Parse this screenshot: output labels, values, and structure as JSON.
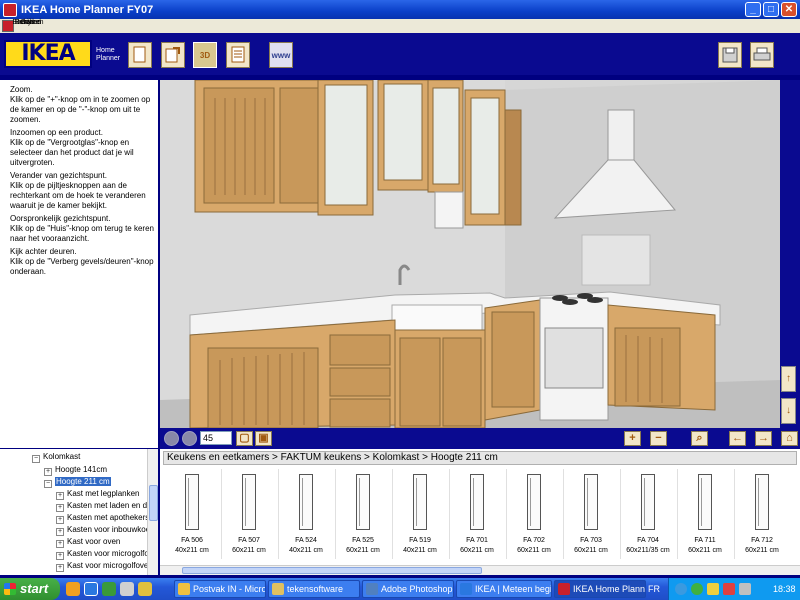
{
  "window": {
    "title": "IKEA Home Planner FY07"
  },
  "menu": [
    "Bestand",
    "Bewerken",
    "Bekijken",
    "Over"
  ],
  "brand": {
    "logo": "IKEA",
    "logo_sub1": "Home",
    "logo_sub2": "Planner"
  },
  "header_buttons": [
    "new-icon",
    "open-icon",
    "3d-view-icon",
    "list-icon",
    "www-icon",
    "save-icon",
    "print-icon"
  ],
  "header_button_labels": {
    "3d": "3D",
    "www": "www"
  },
  "help": [
    "Zoom.",
    "Klik op de \"+\"-knop om in te zoomen op de kamer en op de \"-\"-knop om uit te zoomen.",
    "Inzoomen op een product.",
    "Klik op de \"Vergrootglas\"-knop en selecteer dan het product dat je wil uitvergroten.",
    "Verander van gezichtspunt.",
    "Klik op de pijltjesknoppen aan de rechterkant om de hoek te veranderen waaruit je de kamer bekijkt.",
    "Oorspronkelijk gezichtspunt.",
    "Klik op de \"Huis\"-knop om terug te keren naar het vooraanzicht.",
    "Kijk achter deuren.",
    "Klik op de \"Verberg gevels/deuren\"-knop onderaan."
  ],
  "view_toolbar": {
    "zoom_value": "45"
  },
  "tree": [
    {
      "label": "Kolomkast",
      "toggle": "−",
      "level": 0
    },
    {
      "label": "Hoogte 141cm",
      "toggle": "+",
      "level": 1
    },
    {
      "label": "Hoogte 211 cm",
      "toggle": "−",
      "level": 1,
      "selected": true
    },
    {
      "label": "Kast met legplanken",
      "toggle": "+",
      "level": 2
    },
    {
      "label": "Kasten met laden en draa",
      "toggle": "+",
      "level": 2
    },
    {
      "label": "Kasten met apothekerskas",
      "toggle": "+",
      "level": 2
    },
    {
      "label": "Kasten voor inbouwkoelka",
      "toggle": "+",
      "level": 2
    },
    {
      "label": "Kast voor oven",
      "toggle": "+",
      "level": 2
    },
    {
      "label": "Kasten voor microgolfoven",
      "toggle": "+",
      "level": 2
    },
    {
      "label": "Kast voor microgolfoven",
      "toggle": "+",
      "level": 2
    }
  ],
  "catalog": {
    "breadcrumb": "Keukens en eetkamers > FAKTUM keukens > Kolomkast > Hoogte 211 cm",
    "items": [
      {
        "code": "FA 506",
        "size": "40x211 cm"
      },
      {
        "code": "FA 507",
        "size": "60x211 cm"
      },
      {
        "code": "FA 524",
        "size": "40x211 cm"
      },
      {
        "code": "FA 525",
        "size": "60x211 cm"
      },
      {
        "code": "FA 519",
        "size": "40x211 cm"
      },
      {
        "code": "FA 701",
        "size": "60x211 cm"
      },
      {
        "code": "FA 702",
        "size": "60x211 cm"
      },
      {
        "code": "FA 703",
        "size": "60x211 cm"
      },
      {
        "code": "FA 704",
        "size": "60x211/35 cm"
      },
      {
        "code": "FA 711",
        "size": "60x211 cm"
      },
      {
        "code": "FA 712",
        "size": "60x211 cm"
      }
    ]
  },
  "taskbar": {
    "start": "start",
    "tasks": [
      "Postvak IN - Micros...",
      "tekensoftware",
      "Adobe Photoshop",
      "IKEA | Meteen begi...",
      "IKEA Home Planner ..."
    ],
    "lang": "FR",
    "clock": "18:38"
  },
  "colors": {
    "header": "#0a0a90",
    "logo_yellow": "#ffda1a",
    "wood": "#d8a86a"
  }
}
